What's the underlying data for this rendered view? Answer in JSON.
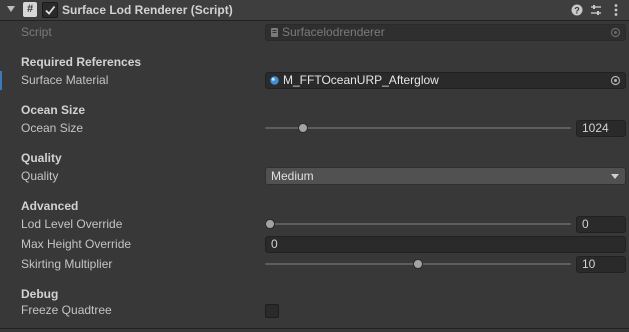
{
  "component": {
    "title": "Surface Lod Renderer (Script)",
    "script_icon": "script-hash-icon",
    "enabled": true
  },
  "header_icons": [
    "help-icon",
    "presets-icon",
    "kebab-menu-icon"
  ],
  "script_row": {
    "label": "Script",
    "value": "Surfacelodrenderer"
  },
  "sections": {
    "required": {
      "header": "Required References",
      "surface_material_label": "Surface Material",
      "surface_material_value": "M_FFTOceanURP_Afterglow"
    },
    "ocean": {
      "header": "Ocean Size",
      "ocean_size_label": "Ocean Size",
      "ocean_size_value": "1024",
      "ocean_size_fraction": 0.11
    },
    "quality": {
      "header": "Quality",
      "quality_label": "Quality",
      "quality_value": "Medium"
    },
    "advanced": {
      "header": "Advanced",
      "lod_level_label": "Lod Level Override",
      "lod_level_value": "0",
      "lod_level_fraction": 0.0,
      "max_height_label": "Max Height Override",
      "max_height_value": "0",
      "skirting_label": "Skirting Multiplier",
      "skirting_value": "10",
      "skirting_fraction": 0.5
    },
    "debug": {
      "header": "Debug",
      "freeze_label": "Freeze Quadtree",
      "freeze_checked": false
    }
  },
  "colors": {
    "accent": "#3a79bb",
    "background": "#383838",
    "field": "#2a2a2a"
  }
}
